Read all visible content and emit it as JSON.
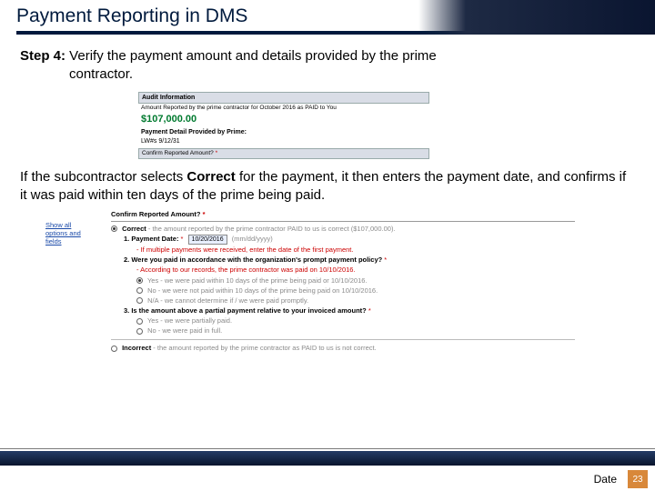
{
  "title": "Payment Reporting in DMS",
  "step": {
    "label": "Step 4:",
    "text_line1": " Verify the payment amount and details provided by the prime",
    "text_line2": "contractor."
  },
  "audit": {
    "heading": "Audit Information",
    "reported_line": "Amount Reported by the prime contractor for October 2016 as PAID to You",
    "amount": "$107,000.00",
    "detail_label": "Payment Detail Provided by Prime:",
    "lw": "LW#s 9/12/31",
    "confirm_label": "Confirm Reported Amount?",
    "star": "*"
  },
  "para2": {
    "a": "If the subcontractor selects ",
    "bold": "Correct",
    "b": " for the payment, it then enters the payment date, and confirms if it was paid within ten days of the prime being paid."
  },
  "form": {
    "heading": "Confirm Reported Amount?",
    "star": "*",
    "side_link": "Show all options and fields",
    "correct_label": "Correct",
    "correct_rest": " - the amount reported by the prime contractor PAID to us is correct ($107,000.00).",
    "q1_label": "1. Payment Date:",
    "q1_star": "*",
    "q1_value": "10/20/2016",
    "q1_hint": "(mm/dd/yyyy)",
    "q1_note": "- If multiple payments were received, enter the date of the first payment.",
    "q2_label": "2. Were you paid in accordance with the organization's prompt payment policy?",
    "q2_star": "*",
    "q2_note": "- According to our records, the prime contractor was paid on 10/10/2016.",
    "q2_opt_yes": "Yes - we were paid within 10 days of the prime being paid or 10/10/2016.",
    "q2_opt_no": "No - we were not paid within 10 days of the prime being paid on 10/10/2016.",
    "q2_opt_na": "N/A - we cannot determine if / we were paid promptly.",
    "q3_label": "3. Is the amount above a partial payment relative to your invoiced amount?",
    "q3_star": "*",
    "q3_opt_yes": "Yes - we were partially paid.",
    "q3_opt_no": "No - we were paid in full.",
    "incorrect_label": "Incorrect",
    "incorrect_rest": " - the amount reported by the prime contractor as PAID to us is not correct."
  },
  "footer": {
    "date": "Date",
    "page": "23"
  }
}
